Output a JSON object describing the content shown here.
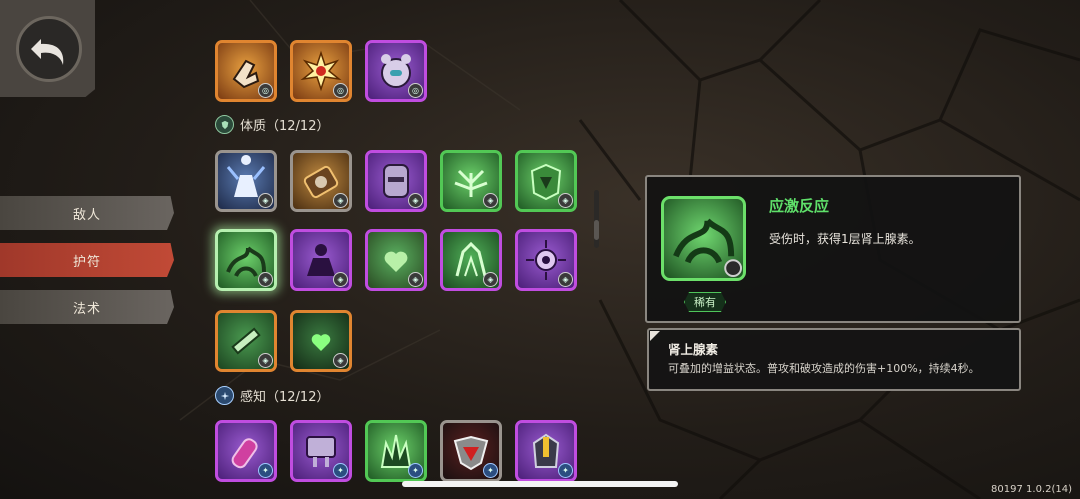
{
  "nav": {
    "tabs": [
      {
        "label": "敌人",
        "active": false
      },
      {
        "label": "护符",
        "active": true
      },
      {
        "label": "法术",
        "active": false
      }
    ]
  },
  "sections": {
    "constitution": {
      "label": "体质（12/12）",
      "icon": "shield-icon"
    },
    "perception": {
      "label": "感知（12/12）",
      "icon": "sparkle-icon"
    }
  },
  "detail": {
    "title": "应激反应",
    "description": "受伤时，获得1层肾上腺素。",
    "rarity": "稀有",
    "effect_title": "肾上腺素",
    "effect_description": "可叠加的增益状态。普攻和破攻造成的伤害+100%，持续4秒。"
  },
  "version": "80197 1.0.2(14)",
  "colors": {
    "active_tab": "#c14a36",
    "green_rarity": "#52c855",
    "purple_rarity": "#c04de0",
    "orange_rarity": "#e08530"
  }
}
